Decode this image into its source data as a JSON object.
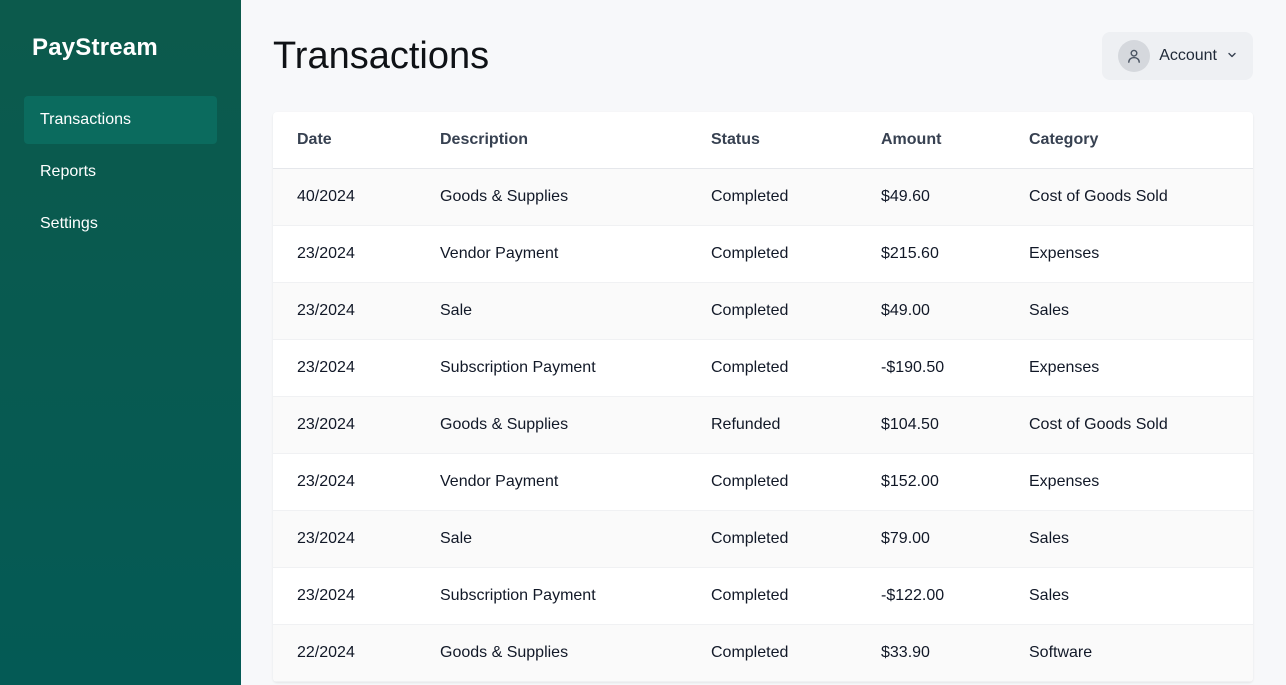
{
  "app": {
    "brand": "PayStream"
  },
  "sidebar": {
    "items": [
      {
        "label": "Transactions",
        "active": true
      },
      {
        "label": "Reports",
        "active": false
      },
      {
        "label": "Settings",
        "active": false
      }
    ]
  },
  "header": {
    "title": "Transactions",
    "account_label": "Account",
    "avatar_icon": "user-icon",
    "chevron_icon": "chevron-down-icon"
  },
  "table": {
    "columns": [
      "Date",
      "Description",
      "Status",
      "Amount",
      "Category"
    ],
    "rows": [
      [
        "40/2024",
        "Goods & Supplies",
        "Completed",
        "$49.60",
        "Cost of Goods Sold"
      ],
      [
        "23/2024",
        "Vendor Payment",
        "Completed",
        "$215.60",
        "Expenses"
      ],
      [
        "23/2024",
        "Sale",
        "Completed",
        "$49.00",
        "Sales"
      ],
      [
        "23/2024",
        "Subscription Payment",
        "Completed",
        "-$190.50",
        "Expenses"
      ],
      [
        "23/2024",
        "Goods & Supplies",
        "Refunded",
        "$104.50",
        "Cost of Goods Sold"
      ],
      [
        "23/2024",
        "Vendor Payment",
        "Completed",
        "$152.00",
        "Expenses"
      ],
      [
        "23/2024",
        "Sale",
        "Completed",
        "$79.00",
        "Sales"
      ],
      [
        "23/2024",
        "Subscription Payment",
        "Completed",
        "-$122.00",
        "Sales"
      ],
      [
        "22/2024",
        "Goods & Supplies",
        "Completed",
        "$33.90",
        "Software"
      ]
    ]
  },
  "colors": {
    "sidebar": "#0c5a4c",
    "sidebar_active": "#0b6b5e",
    "background": "#f7f8fa"
  }
}
